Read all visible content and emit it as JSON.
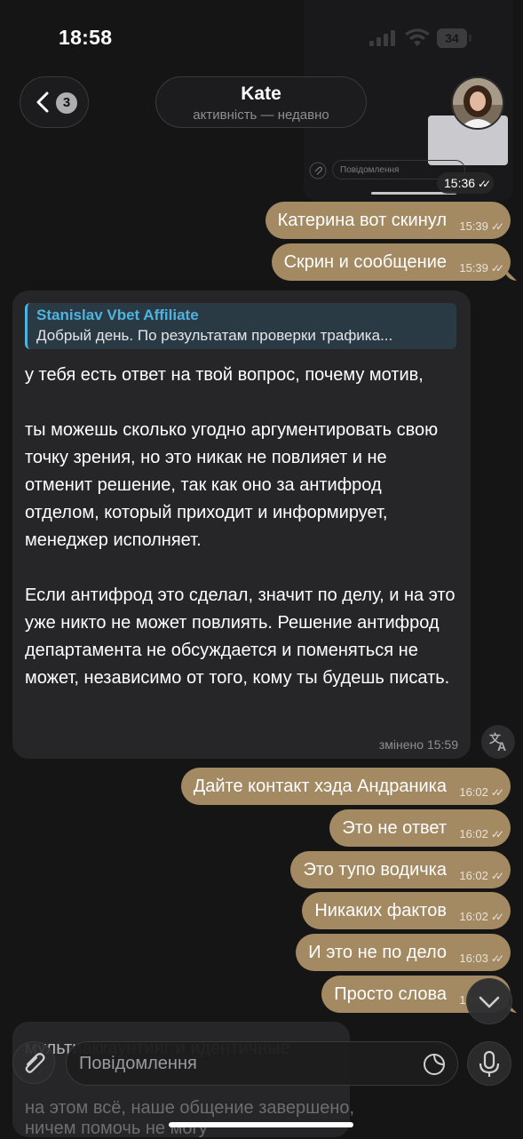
{
  "status_bar": {
    "time": "18:58",
    "battery": "34"
  },
  "header": {
    "back_count": "3",
    "name": "Kate",
    "status": "активність — недавно"
  },
  "image_message": {
    "input_placeholder": "Повідомлення",
    "time": "15:36"
  },
  "outgoing_top": [
    {
      "text": "Катерина вот скинул",
      "time": "15:39"
    },
    {
      "text": "Скрин и сообщение",
      "time": "15:39"
    }
  ],
  "incoming": {
    "quote_author": "Stanislav Vbet Affiliate",
    "quote_text": "Добрый день. По результатам проверки трафика...",
    "paragraphs": [
      "у тебя есть ответ на твой вопрос, почему мотив,",
      "ты можешь сколько угодно аргументировать свою точку зрения, но это никак не повлияет и не отменит решение, так как оно за антифрод отделом, который приходит и информирует, менеджер исполняет.",
      "Если антифрод это сделал, значит по делу, и на это уже никто не может повлиять. Решение антифрод департамента не обсуждается и поменяться не может, независимо от того, кому ты будешь писать."
    ],
    "edited_label": "змінено 15:59"
  },
  "outgoing_bottom": [
    {
      "text": "Дайте контакт хэда Андраника",
      "time": "16:02"
    },
    {
      "text": "Это не ответ",
      "time": "16:02"
    },
    {
      "text": "Это тупо водичка",
      "time": "16:02"
    },
    {
      "text": "Никаких фактов",
      "time": "16:02"
    },
    {
      "text": "И это не по дело",
      "time": "16:03"
    },
    {
      "text": "Просто слова",
      "time": "16:03"
    }
  ],
  "incoming_peek": {
    "line1": "мультиаккаунтинг и идентичные",
    "line2": "на этом всё, наше общение завершено,",
    "line3": "ничем помочь не могу"
  },
  "input": {
    "placeholder": "Повідомлення"
  },
  "colors": {
    "outgoing_bubble": "#a38a63",
    "incoming_bubble": "#262628",
    "quote_accent": "#4fb3e0",
    "background": "#151515"
  }
}
